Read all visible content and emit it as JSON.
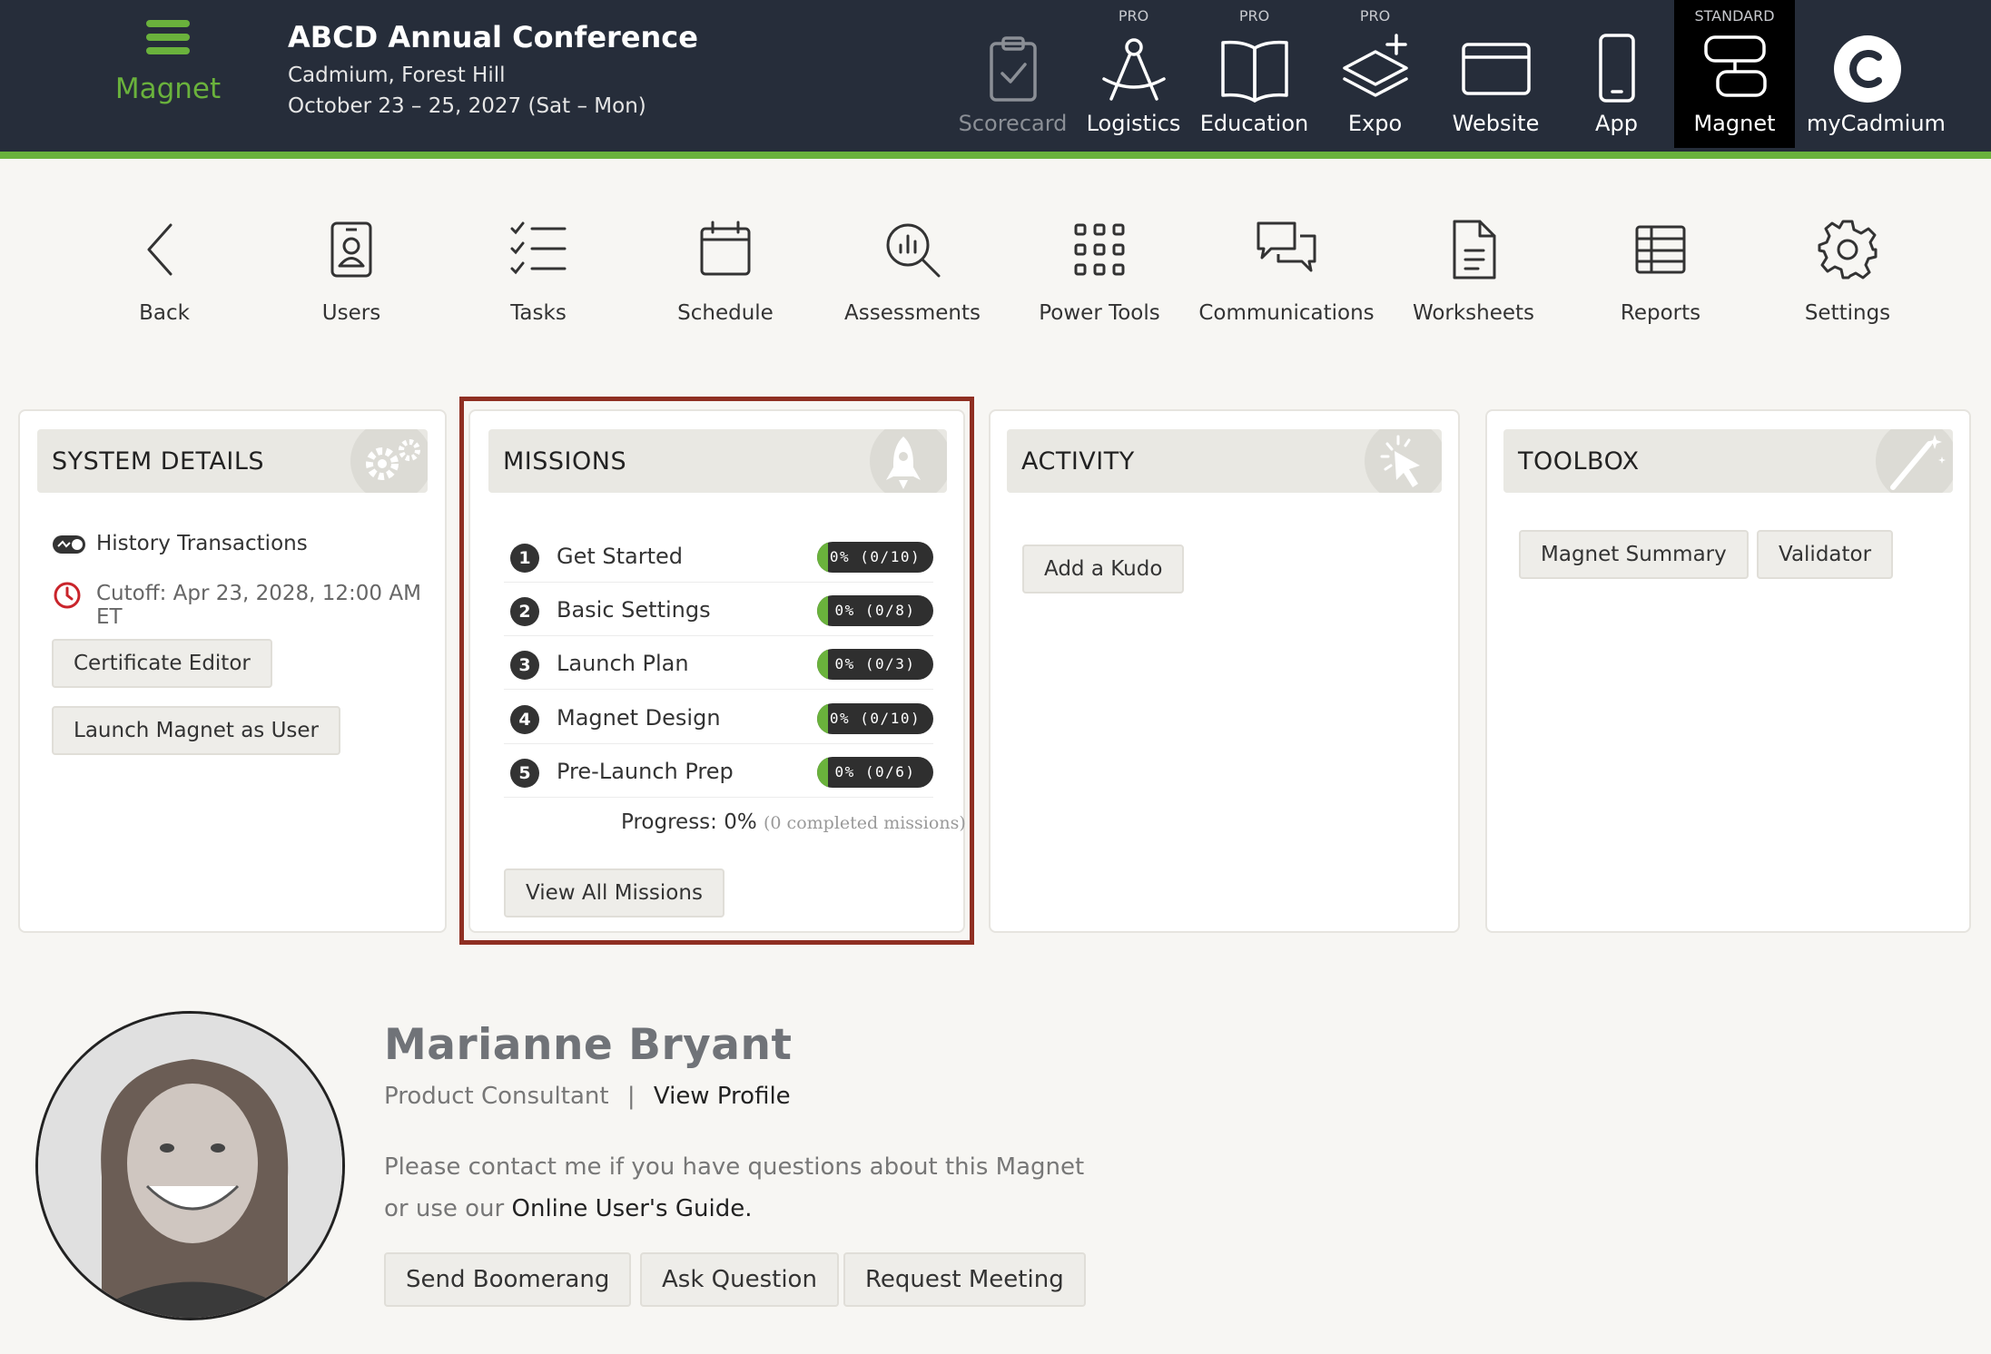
{
  "brand": {
    "label": "Magnet"
  },
  "conference": {
    "title": "ABCD Annual Conference",
    "venue": "Cadmium, Forest Hill",
    "dates": "October 23 – 25, 2027 (Sat – Mon)"
  },
  "topnav": [
    {
      "label": "Scorecard",
      "tier": "",
      "icon": "clipboard-check-icon",
      "state": "disabled"
    },
    {
      "label": "Logistics",
      "tier": "PRO",
      "icon": "compass-icon",
      "state": "normal"
    },
    {
      "label": "Education",
      "tier": "PRO",
      "icon": "book-icon",
      "state": "normal"
    },
    {
      "label": "Expo",
      "tier": "PRO",
      "icon": "layers-plus-icon",
      "state": "normal"
    },
    {
      "label": "Website",
      "tier": "",
      "icon": "browser-window-icon",
      "state": "normal"
    },
    {
      "label": "App",
      "tier": "",
      "icon": "smartphone-icon",
      "state": "normal"
    },
    {
      "label": "Magnet",
      "tier": "STANDARD",
      "icon": "magnet-icon",
      "state": "active"
    },
    {
      "label": "myCadmium",
      "tier": "",
      "icon": "cadmium-logo-icon",
      "state": "normal"
    }
  ],
  "toolbar": [
    {
      "label": "Back",
      "icon": "chevron-left-icon"
    },
    {
      "label": "Users",
      "icon": "id-badge-icon"
    },
    {
      "label": "Tasks",
      "icon": "checklist-icon"
    },
    {
      "label": "Schedule",
      "icon": "calendar-icon"
    },
    {
      "label": "Assessments",
      "icon": "magnify-chart-icon"
    },
    {
      "label": "Power Tools",
      "icon": "grid-dots-icon"
    },
    {
      "label": "Communications",
      "icon": "chat-bubbles-icon"
    },
    {
      "label": "Worksheets",
      "icon": "document-icon"
    },
    {
      "label": "Reports",
      "icon": "table-icon"
    },
    {
      "label": "Settings",
      "icon": "gear-icon"
    }
  ],
  "system": {
    "title": "SYSTEM DETAILS",
    "history": "History Transactions",
    "cutoff": "Cutoff: Apr 23, 2028, 12:00 AM ET",
    "buttons": [
      "Certificate Editor",
      "Launch Magnet as User"
    ]
  },
  "missions": {
    "title": "MISSIONS",
    "items": [
      {
        "num": "1",
        "name": "Get Started",
        "progress": "0% (0/10)",
        "fraction": 0
      },
      {
        "num": "2",
        "name": "Basic Settings",
        "progress": "0% (0/8)",
        "fraction": 0
      },
      {
        "num": "3",
        "name": "Launch Plan",
        "progress": "0% (0/3)",
        "fraction": 0
      },
      {
        "num": "4",
        "name": "Magnet Design",
        "progress": "0% (0/10)",
        "fraction": 0
      },
      {
        "num": "5",
        "name": "Pre-Launch Prep",
        "progress": "0% (0/6)",
        "fraction": 0
      }
    ],
    "progress_label": "Progress: 0%",
    "progress_note": "(0 completed missions)",
    "view_all": "View All Missions"
  },
  "activity": {
    "title": "ACTIVITY",
    "button": "Add a Kudo"
  },
  "toolbox": {
    "title": "TOOLBOX",
    "buttons": [
      "Magnet Summary",
      "Validator"
    ]
  },
  "consultant": {
    "name": "Marianne Bryant",
    "role": "Product Consultant",
    "separator": "|",
    "profile_link": "View Profile",
    "message_line1": "Please contact me if you have questions about this Magnet",
    "message_line2": "or use our ",
    "guide_link": "Online User's Guide",
    "guide_end": ".",
    "buttons": [
      "Send Boomerang",
      "Ask Question",
      "Request Meeting"
    ]
  },
  "colors": {
    "topbar": "#262d3a",
    "accent": "#6ab23c",
    "highlight": "#8f2f22"
  }
}
